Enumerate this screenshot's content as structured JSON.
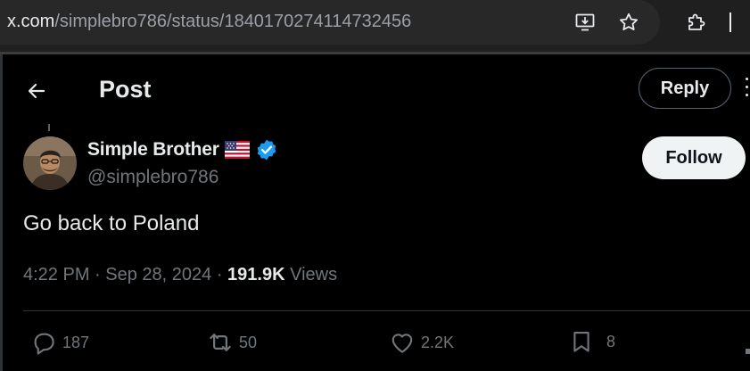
{
  "browser": {
    "url_host": "x.com",
    "url_path": "/simplebro786/status/1840170274114732456",
    "icons": [
      "install-app-icon",
      "bookmark-star-icon",
      "extensions-icon"
    ]
  },
  "header": {
    "title": "Post",
    "reply_label": "Reply"
  },
  "post": {
    "author": {
      "display_name": "Simple Brother",
      "handle": "@simplebro786",
      "verified": true,
      "flag": "us-flag-icon"
    },
    "follow_label": "Follow",
    "text": "Go back to Poland",
    "time": "4:22 PM",
    "date": "Sep 28, 2024",
    "views_count": "191.9K",
    "views_label": "Views"
  },
  "actions": {
    "replies": "187",
    "reposts": "50",
    "likes": "2.2K",
    "bookmarks": "8"
  },
  "colors": {
    "background": "#000000",
    "text_primary": "#e7e9ea",
    "text_secondary": "#71767b",
    "verified_blue": "#1d9bf0",
    "divider": "#2f3336"
  }
}
